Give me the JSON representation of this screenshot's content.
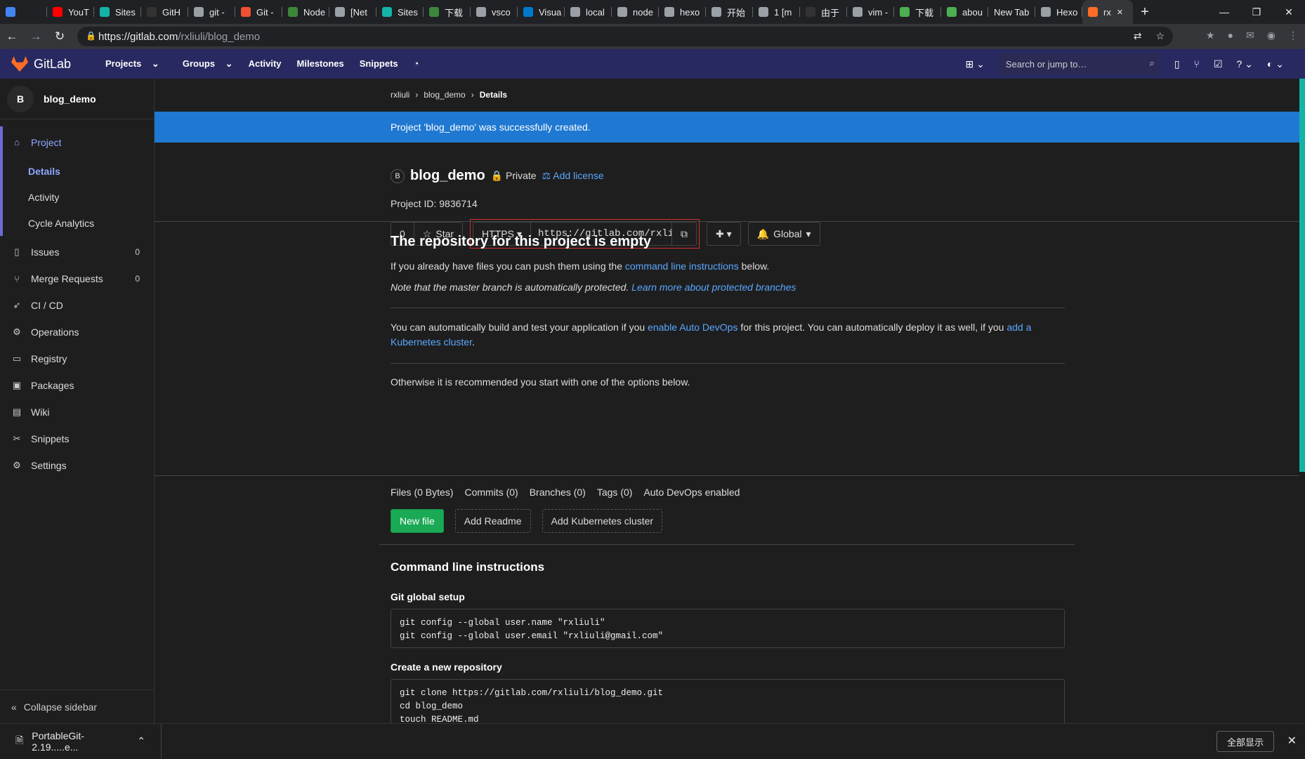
{
  "browser": {
    "tabs": [
      {
        "label": "",
        "color": "#4285f4"
      },
      {
        "label": "YouT",
        "color": "#ff0000"
      },
      {
        "label": "Sites",
        "color": "#14b3a8"
      },
      {
        "label": "GitH",
        "color": "#333333"
      },
      {
        "label": "git -",
        "color": "#9aa0a6"
      },
      {
        "label": "Git -",
        "color": "#f05032"
      },
      {
        "label": "Node",
        "color": "#3c873a"
      },
      {
        "label": "[Net",
        "color": "#9aa0a6"
      },
      {
        "label": "Sites",
        "color": "#14b3a8"
      },
      {
        "label": "下载",
        "color": "#3c873a"
      },
      {
        "label": "vsco",
        "color": "#9aa0a6"
      },
      {
        "label": "Visua",
        "color": "#007acc"
      },
      {
        "label": "local",
        "color": "#9aa0a6"
      },
      {
        "label": "node",
        "color": "#9aa0a6"
      },
      {
        "label": "hexo",
        "color": "#9aa0a6"
      },
      {
        "label": "开始",
        "color": "#9aa0a6"
      },
      {
        "label": "1 [m",
        "color": "#9aa0a6"
      },
      {
        "label": "由于",
        "color": "#333333"
      },
      {
        "label": "vim -",
        "color": "#9aa0a6"
      },
      {
        "label": "下载",
        "color": "#4caf50"
      },
      {
        "label": "abou",
        "color": "#4caf50"
      },
      {
        "label": "New Tab",
        "color": ""
      },
      {
        "label": "Hexo",
        "color": "#9aa0a6"
      },
      {
        "label": "rx",
        "color": "#fc6d26"
      }
    ],
    "url_host": "https://gitlab.com",
    "url_path": "/rxliuli/blog_demo",
    "window": {
      "minimize": "—",
      "restore": "❐",
      "close": "✕"
    }
  },
  "gitlab": {
    "nav": {
      "logo": "GitLab",
      "projects": "Projects",
      "groups": "Groups",
      "activity": "Activity",
      "milestones": "Milestones",
      "snippets": "Snippets"
    },
    "search_placeholder": "Search or jump to…"
  },
  "sidebar": {
    "avatar": "B",
    "project_name": "blog_demo",
    "project": "Project",
    "sub": [
      "Details",
      "Activity",
      "Cycle Analytics"
    ],
    "items": [
      {
        "label": "Issues",
        "count": "0",
        "icon": "issues-icon"
      },
      {
        "label": "Merge Requests",
        "count": "0",
        "icon": "merge-request-icon"
      },
      {
        "label": "CI / CD",
        "icon": "rocket-icon"
      },
      {
        "label": "Operations",
        "icon": "operations-icon"
      },
      {
        "label": "Registry",
        "icon": "registry-icon"
      },
      {
        "label": "Packages",
        "icon": "packages-icon"
      },
      {
        "label": "Wiki",
        "icon": "wiki-icon"
      },
      {
        "label": "Snippets",
        "icon": "snippets-icon"
      },
      {
        "label": "Settings",
        "icon": "settings-icon"
      }
    ],
    "collapse": "Collapse sidebar"
  },
  "main": {
    "breadcrumb": [
      "rxliuli",
      "blog_demo",
      "Details"
    ],
    "flash": "Project 'blog_demo' was successfully created.",
    "avatar": "B",
    "title": "blog_demo",
    "visibility": "Private",
    "add_license": "Add license",
    "project_id": "Project ID: 9836714",
    "star_count": "0",
    "star_label": "Star",
    "clone_protocol": "HTTPS",
    "clone_url": "https://gitlab.com/rxliuli/blog_demo.git",
    "notify": "Global",
    "empty_title": "The repository for this project is empty",
    "push_pre": "If you already have files you can push them using the ",
    "push_link": "command line instructions",
    "push_post": " below.",
    "note_pre": "Note that the master branch is automatically protected. ",
    "note_link": "Learn more about protected branches",
    "devops_1": "You can automatically build and test your application if you ",
    "devops_link1": "enable Auto DevOps",
    "devops_2": " for this project. You can automatically deploy it as well, if you ",
    "devops_link2": "add a Kubernetes cluster",
    "devops_3": ".",
    "otherwise": "Otherwise it is recommended you start with one of the options below.",
    "stats": [
      "Files (0 Bytes)",
      "Commits (0)",
      "Branches (0)",
      "Tags (0)",
      "Auto DevOps enabled"
    ],
    "new_file": "New file",
    "add_readme": "Add Readme",
    "add_k8s": "Add Kubernetes cluster",
    "cli_title": "Command line instructions",
    "git_global": "Git global setup",
    "git_global_code": "git config --global user.name \"rxliuli\"\ngit config --global user.email \"rxliuli@gmail.com\"",
    "create_repo": "Create a new repository",
    "create_repo_code": "git clone https://gitlab.com/rxliuli/blog_demo.git\ncd blog_demo\ntouch README.md"
  },
  "downloads": {
    "file": "PortableGit-2.19.....e...",
    "show_all": "全部显示"
  }
}
